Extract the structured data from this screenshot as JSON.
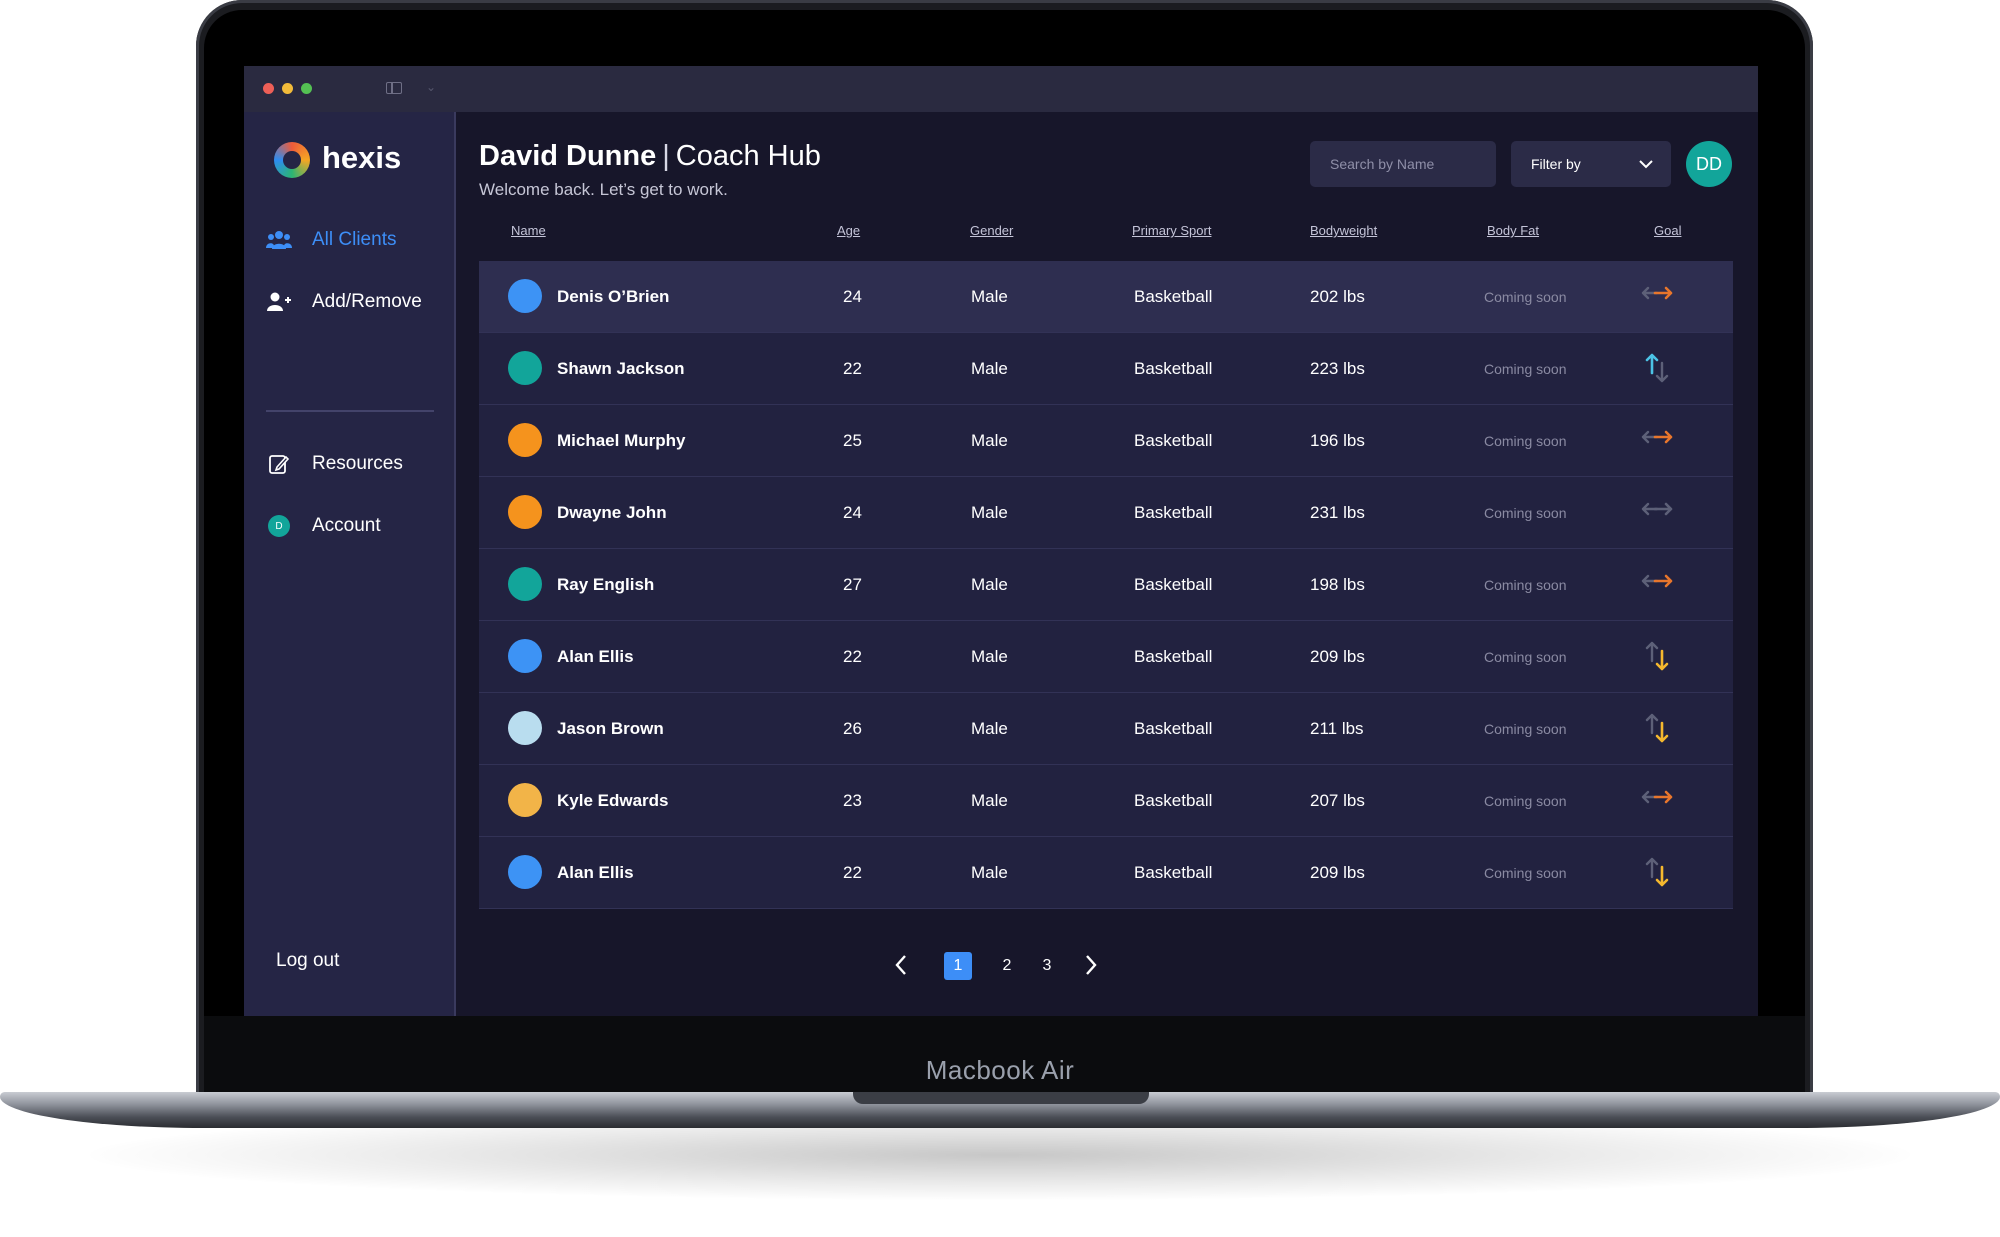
{
  "window": {
    "device_label": "Macbook Air"
  },
  "sidebar": {
    "brand": "hexis",
    "items": [
      {
        "label": "All Clients",
        "icon": "users-icon",
        "active": true
      },
      {
        "label": "Add/Remove",
        "icon": "add-user-icon",
        "active": false
      },
      {
        "label": "Resources",
        "icon": "document-edit-icon",
        "active": false
      },
      {
        "label": "Account",
        "icon": "account-avatar-icon",
        "active": false,
        "avatar_initial": "D"
      }
    ],
    "logout_label": "Log out"
  },
  "header": {
    "coach_name": "David Dunne",
    "separator": "|",
    "hub_name": "Coach Hub",
    "subtitle": "Welcome back. Let’s get to work.",
    "search_placeholder": "Search by Name",
    "filter_label": "Filter by",
    "avatar_initials": "DD"
  },
  "table": {
    "columns": [
      "Name",
      "Age",
      "Gender",
      "Primary Sport",
      "Bodyweight",
      "Body Fat",
      "Goal"
    ],
    "rows": [
      {
        "name": "Denis O’Brien",
        "age": "24",
        "gender": "Male",
        "sport": "Basketball",
        "bodyweight": "202 lbs",
        "body_fat": "Coming soon",
        "goal": "maintain",
        "avatar_color": "#3d93f5",
        "selected": true
      },
      {
        "name": "Shawn Jackson",
        "age": "22",
        "gender": "Male",
        "sport": "Basketball",
        "bodyweight": "223 lbs",
        "body_fat": "Coming soon",
        "goal": "gain",
        "avatar_color": "#12a59a",
        "selected": false
      },
      {
        "name": "Michael Murphy",
        "age": "25",
        "gender": "Male",
        "sport": "Basketball",
        "bodyweight": "196 lbs",
        "body_fat": "Coming soon",
        "goal": "maintain",
        "avatar_color": "#f5931d",
        "selected": false
      },
      {
        "name": "Dwayne John",
        "age": "24",
        "gender": "Male",
        "sport": "Basketball",
        "bodyweight": "231 lbs",
        "body_fat": "Coming soon",
        "goal": "maintain-muted",
        "avatar_color": "#f5931d",
        "selected": false
      },
      {
        "name": "Ray English",
        "age": "27",
        "gender": "Male",
        "sport": "Basketball",
        "bodyweight": "198 lbs",
        "body_fat": "Coming soon",
        "goal": "maintain",
        "avatar_color": "#12a59a",
        "selected": false
      },
      {
        "name": "Alan Ellis",
        "age": "22",
        "gender": "Male",
        "sport": "Basketball",
        "bodyweight": "209 lbs",
        "body_fat": "Coming soon",
        "goal": "lose",
        "avatar_color": "#3d93f5",
        "selected": false
      },
      {
        "name": "Jason Brown",
        "age": "26",
        "gender": "Male",
        "sport": "Basketball",
        "bodyweight": "211 lbs",
        "body_fat": "Coming soon",
        "goal": "lose",
        "avatar_color": "#b9ddef",
        "selected": false
      },
      {
        "name": "Kyle Edwards",
        "age": "23",
        "gender": "Male",
        "sport": "Basketball",
        "bodyweight": "207 lbs",
        "body_fat": "Coming soon",
        "goal": "maintain",
        "avatar_color": "#f2b448",
        "selected": false
      },
      {
        "name": "Alan Ellis",
        "age": "22",
        "gender": "Male",
        "sport": "Basketball",
        "bodyweight": "209 lbs",
        "body_fat": "Coming soon",
        "goal": "lose",
        "avatar_color": "#3d93f5",
        "selected": false
      }
    ]
  },
  "pagination": {
    "pages": [
      "1",
      "2",
      "3"
    ],
    "current": "1",
    "prev_icon": "chevron-left-icon",
    "next_icon": "chevron-right-icon"
  },
  "colors": {
    "accent": "#3d8ef7",
    "teal": "#12a59a",
    "goal_orange": "#e8762c",
    "goal_yellow": "#f5b82e",
    "goal_cyan": "#4cc3e6",
    "goal_muted": "#5d6078"
  }
}
